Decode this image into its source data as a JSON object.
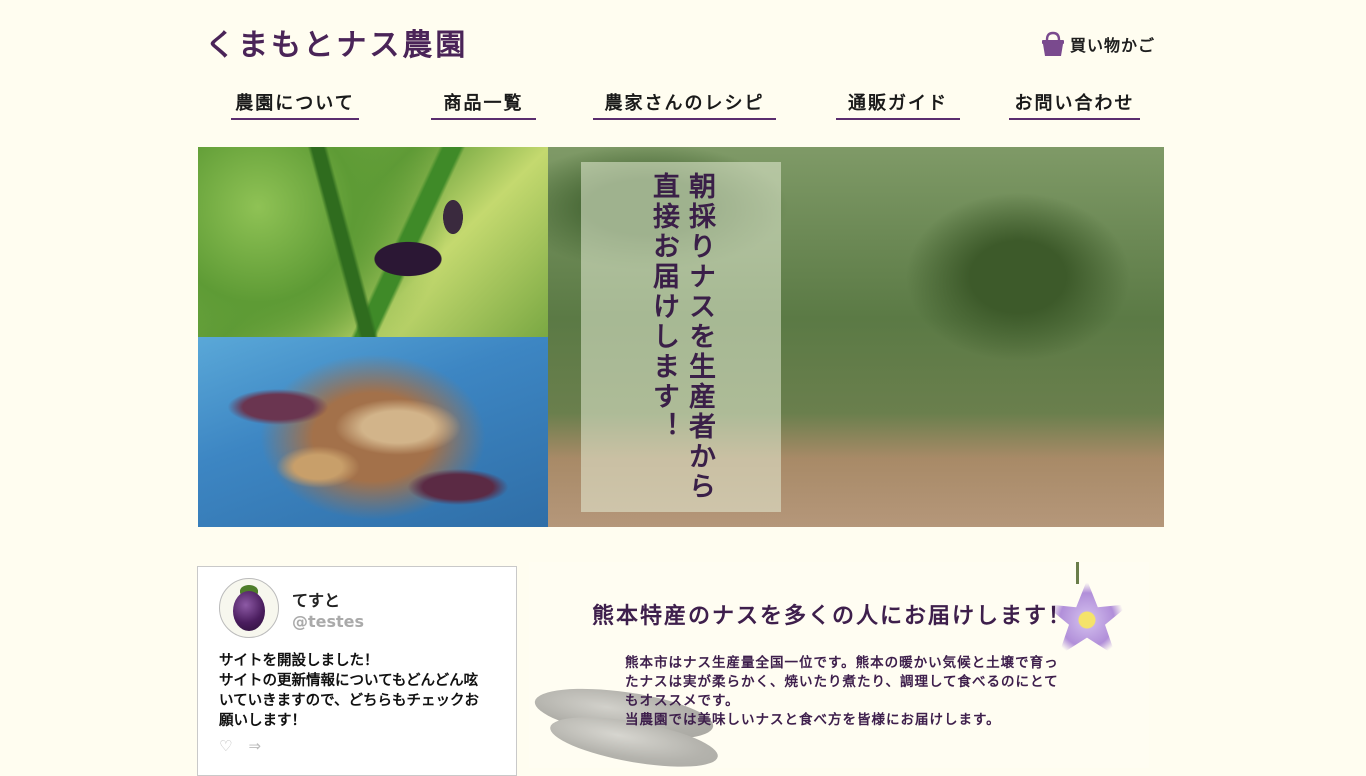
{
  "site": {
    "logo": "くまもとナス農園",
    "cart_label": "買い物かご"
  },
  "nav": [
    {
      "label": "農園について"
    },
    {
      "label": "商品一覧"
    },
    {
      "label": "農家さんのレシピ"
    },
    {
      "label": "通販ガイド"
    },
    {
      "label": "お問い合わせ"
    }
  ],
  "hero": {
    "caption": "朝採りナスを生産者から\n直接お届けします！"
  },
  "tweet": {
    "name": "てすと",
    "handle": "@testes",
    "body": "サイトを開設しました！\nサイトの更新情報についてもどんどん呟いていきますので、どちらもチェックお願いします！",
    "like_icon": "heart-icon",
    "share_icon": "share-arrow-icon"
  },
  "promo": {
    "title": "熊本特産のナスを多くの人にお届けします！",
    "text": "熊本市はナス生産量全国一位です。熊本の暖かい気候と土壌で育ったナスは実が柔らかく、焼いたり煮たり、調理して食べるのにとてもオススメです。\n当農園では美味しいナスと食べ方を皆様にお届けします。"
  },
  "colors": {
    "background": "#fffdf0",
    "accent": "#5a2d6e",
    "cart_icon": "#7a4a8e"
  }
}
